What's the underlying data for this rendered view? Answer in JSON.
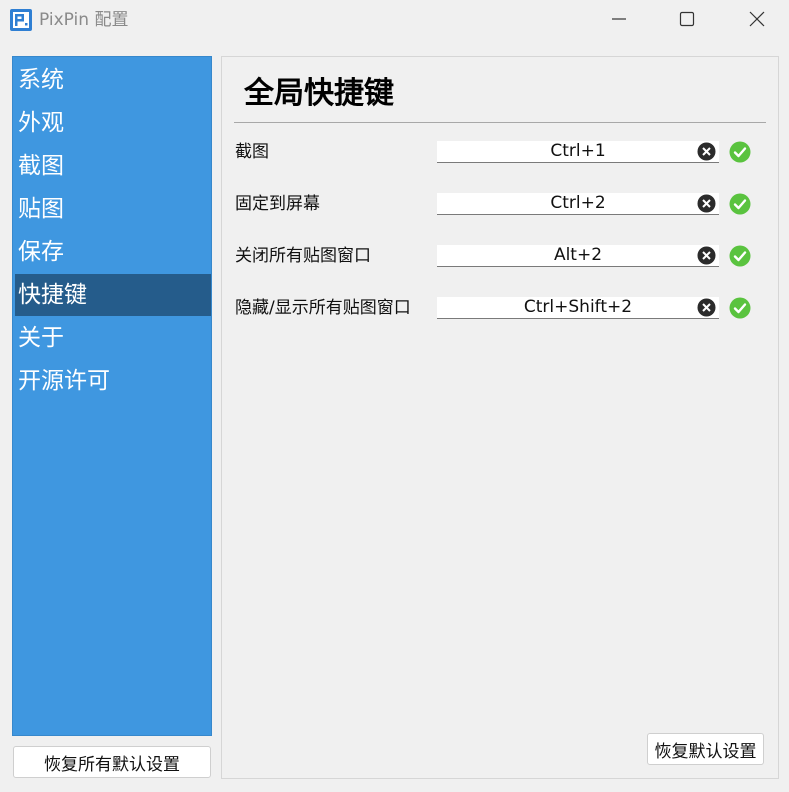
{
  "window": {
    "title": "PixPin 配置"
  },
  "sidebar": {
    "items": [
      {
        "label": "系统"
      },
      {
        "label": "外观"
      },
      {
        "label": "截图"
      },
      {
        "label": "贴图"
      },
      {
        "label": "保存"
      },
      {
        "label": "快捷键",
        "active": true
      },
      {
        "label": "关于"
      },
      {
        "label": "开源许可"
      }
    ],
    "restore_all_label": "恢复所有默认设置"
  },
  "main": {
    "title": "全局快捷键",
    "shortcuts": [
      {
        "label": "截图",
        "value": "Ctrl+1"
      },
      {
        "label": "固定到屏幕",
        "value": "Ctrl+2"
      },
      {
        "label": "关闭所有贴图窗口",
        "value": "Alt+2"
      },
      {
        "label": "隐藏/显示所有贴图窗口",
        "value": "Ctrl+Shift+2"
      }
    ],
    "restore_default_label": "恢复默认设置"
  },
  "colors": {
    "sidebar_bg": "#3f97e0",
    "sidebar_active": "#255c8b",
    "success_green": "#5ac33f",
    "clear_icon_dark": "#2b2b2b"
  },
  "icons": {
    "app": "pixpin-logo-icon",
    "minimize": "minimize-icon",
    "maximize": "maximize-icon",
    "close": "close-icon",
    "clear": "clear-circle-x-icon",
    "valid": "check-circle-icon"
  }
}
